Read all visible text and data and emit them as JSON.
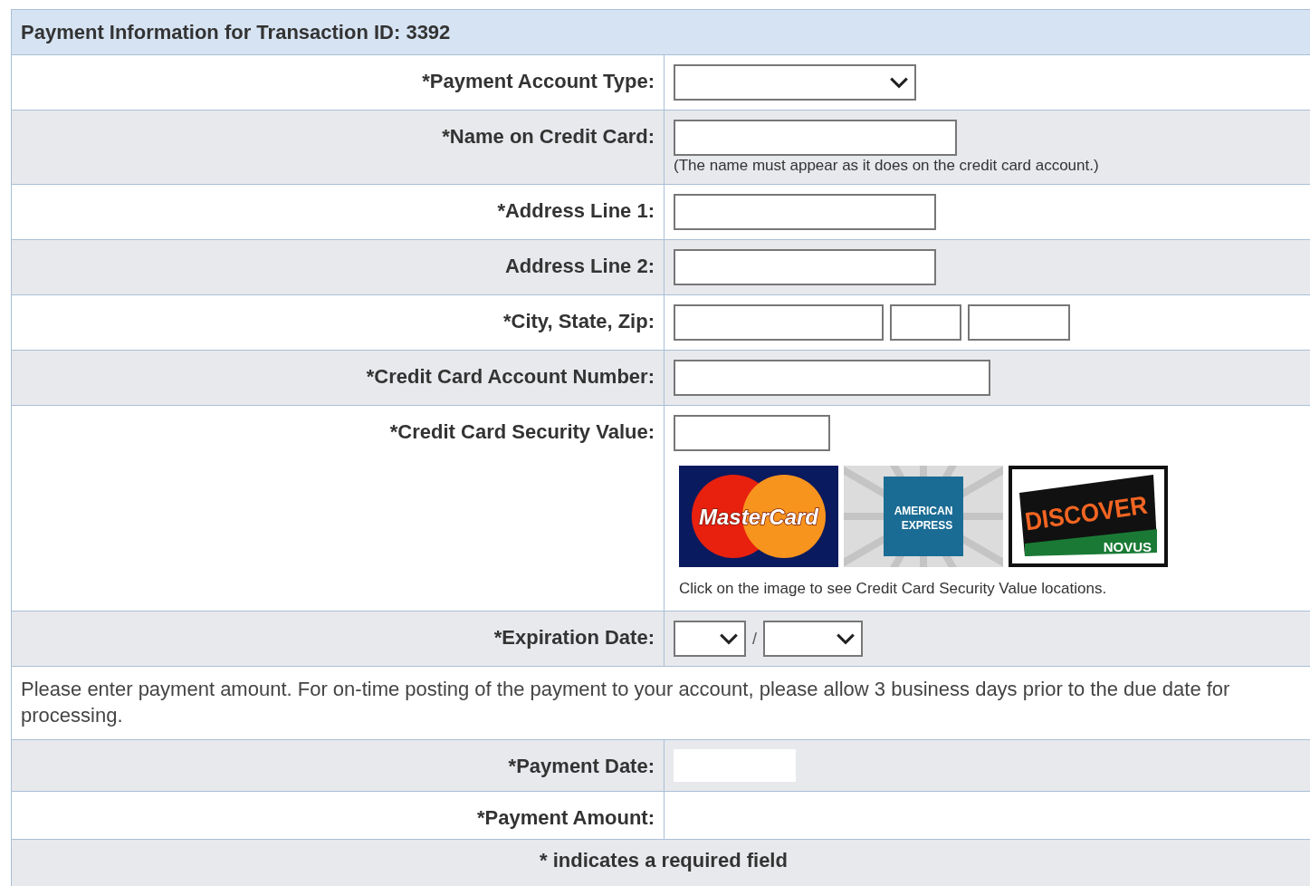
{
  "header": {
    "title": "Payment Information for Transaction ID: 3392"
  },
  "rows": [
    {
      "kind": "field",
      "label": "*Payment Account Type:",
      "fields": [
        {
          "kind": "select"
        }
      ]
    },
    {
      "kind": "field",
      "label": "*Name on Credit Card:",
      "fields": [
        {
          "kind": "text"
        }
      ],
      "hint": "(The name must appear as it does on the credit card account.)"
    },
    {
      "kind": "field",
      "label": "*Address Line 1:",
      "fields": [
        {
          "kind": "text"
        }
      ]
    },
    {
      "kind": "field",
      "label": "Address Line 2:",
      "fields": [
        {
          "kind": "text"
        }
      ]
    },
    {
      "kind": "field",
      "label": "*City, State, Zip:",
      "fields": [
        {
          "kind": "text"
        },
        {
          "kind": "text"
        },
        {
          "kind": "text"
        }
      ]
    },
    {
      "kind": "field",
      "label": "*Credit Card Account Number:",
      "fields": [
        {
          "kind": "text"
        }
      ]
    },
    {
      "kind": "field",
      "label": "*Credit Card Security Value:",
      "fields": [
        {
          "kind": "text"
        }
      ],
      "cards": [
        {
          "kind": "mastercard",
          "words": [
            "MasterCard"
          ]
        },
        {
          "kind": "amex",
          "words": [
            "AMERICAN",
            "EXPRESS"
          ]
        },
        {
          "kind": "discover",
          "words": [
            "DISCOVER",
            "NOVUS"
          ]
        }
      ],
      "hint": "Click on the image to see Credit Card Security Value locations."
    },
    {
      "kind": "field",
      "label": "*Expiration Date:",
      "fields": [
        {
          "kind": "select"
        },
        {
          "kind": "sep",
          "text": "/"
        },
        {
          "kind": "select"
        }
      ]
    },
    {
      "kind": "note",
      "text": "Please enter payment amount. For on-time posting of the payment to your account, please allow 3 business days prior to the due date for processing."
    },
    {
      "kind": "field",
      "label": "*Payment Date:",
      "fields": [
        {
          "kind": "plain"
        }
      ]
    },
    {
      "kind": "field",
      "label": "*Payment Amount:",
      "fields": []
    },
    {
      "kind": "footer",
      "text": "* indicates a required field"
    }
  ]
}
